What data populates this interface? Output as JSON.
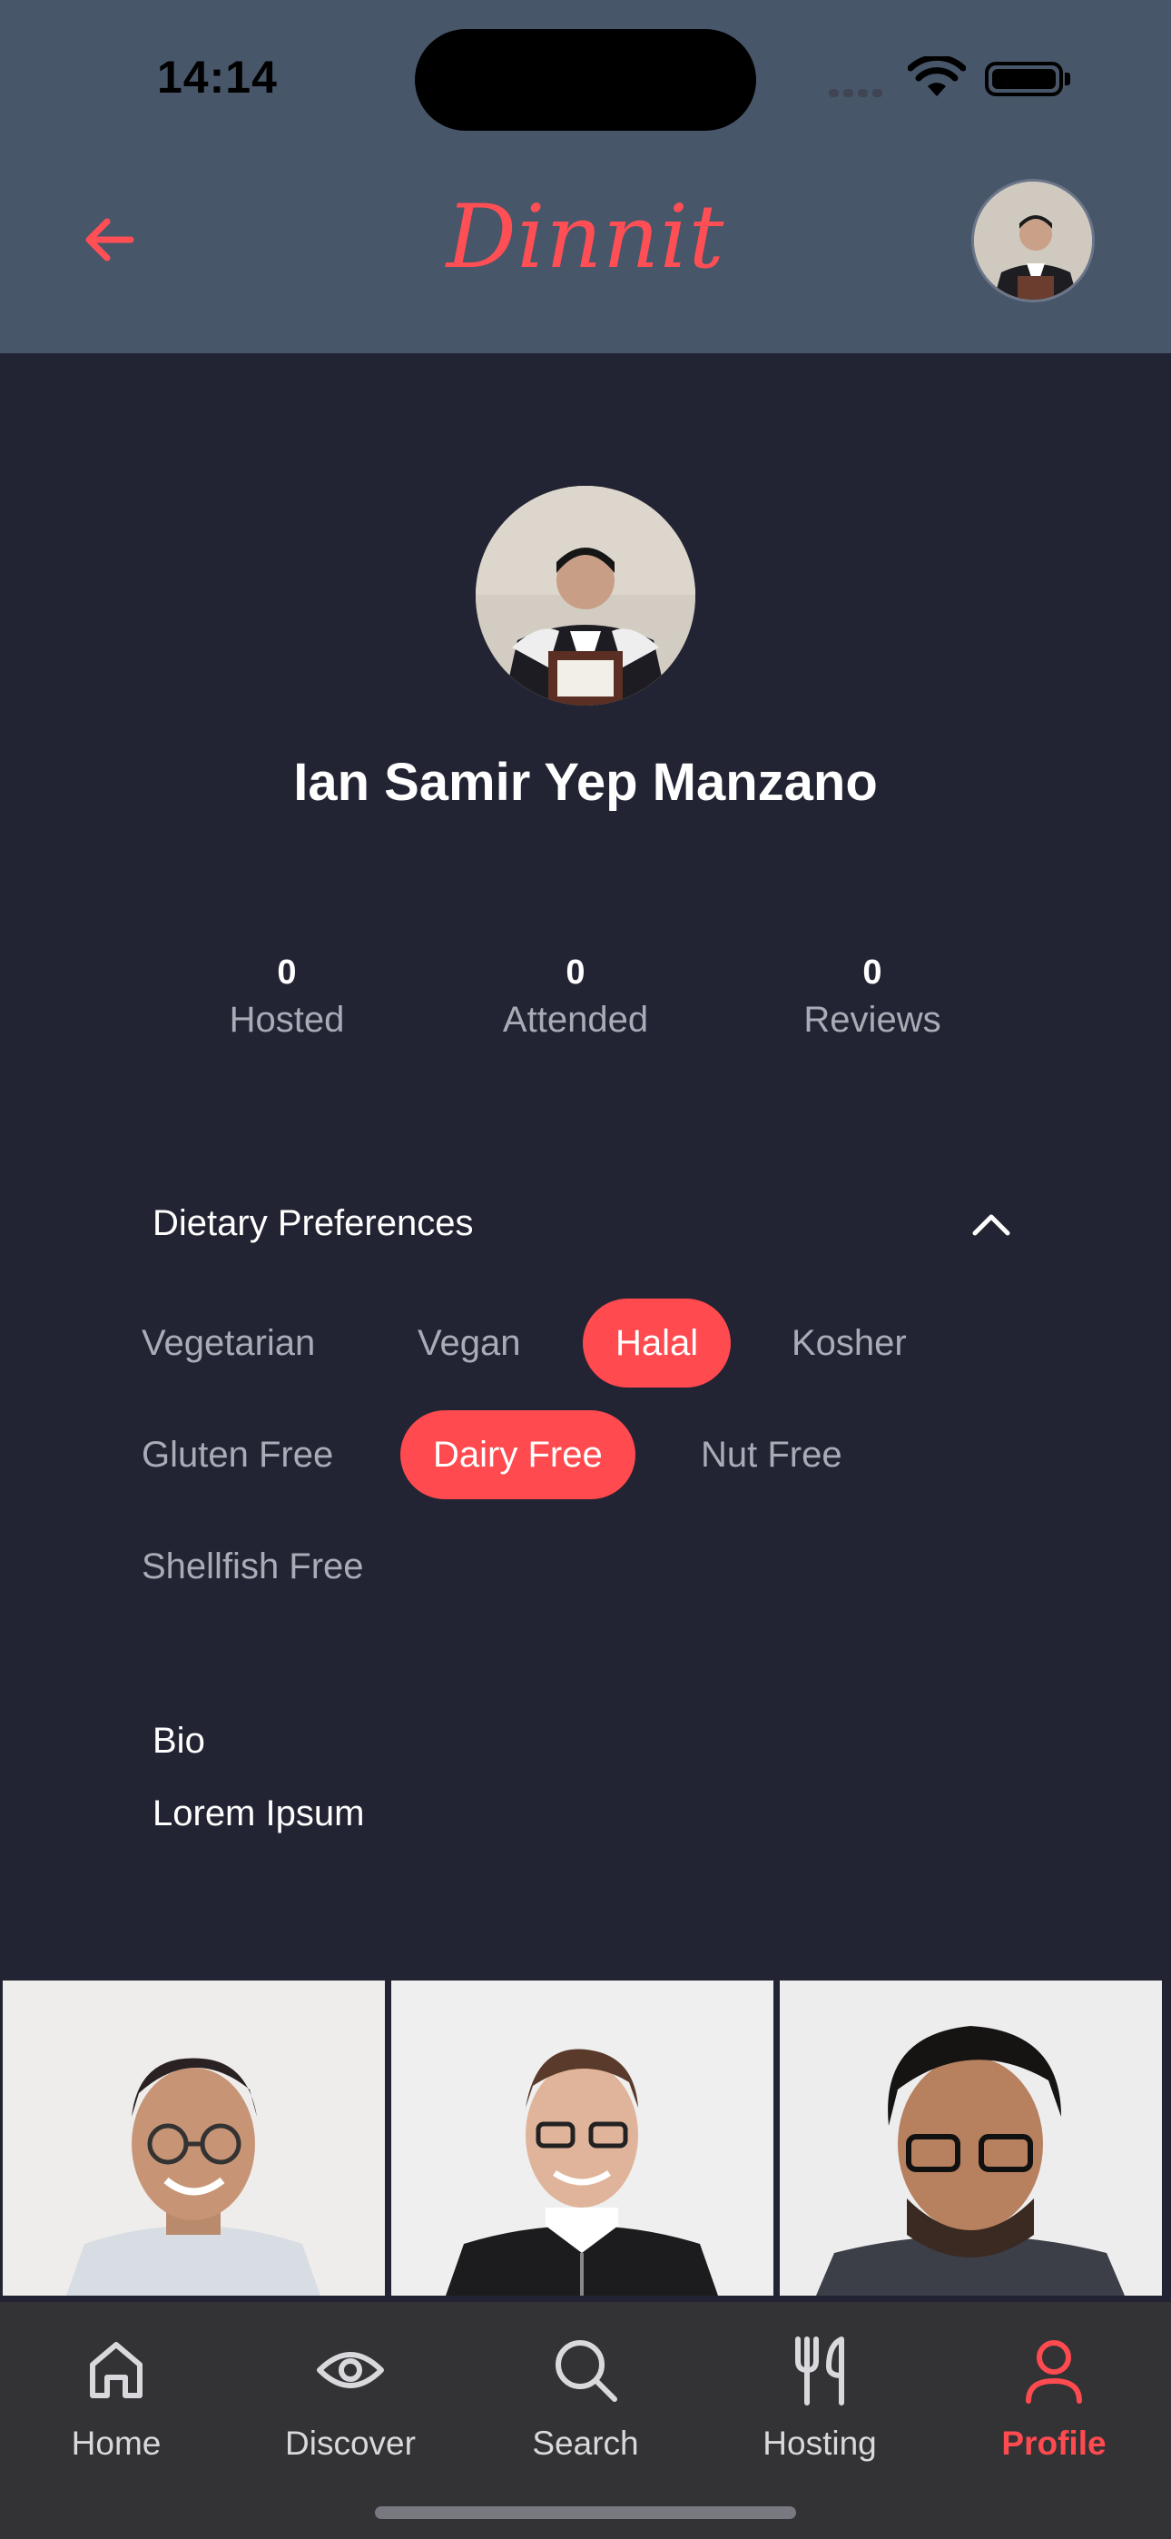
{
  "status_bar": {
    "time": "14:14"
  },
  "header": {
    "logo": "Dinnit"
  },
  "profile": {
    "name": "Ian Samir Yep Manzano"
  },
  "stats": [
    {
      "value": "0",
      "label": "Hosted"
    },
    {
      "value": "0",
      "label": "Attended"
    },
    {
      "value": "0",
      "label": "Reviews"
    }
  ],
  "dietary": {
    "title": "Dietary Preferences",
    "options": [
      {
        "label": "Vegetarian",
        "selected": false
      },
      {
        "label": "Vegan",
        "selected": false
      },
      {
        "label": "Halal",
        "selected": true
      },
      {
        "label": "Kosher",
        "selected": false
      },
      {
        "label": "Gluten Free",
        "selected": false
      },
      {
        "label": "Dairy Free",
        "selected": true
      },
      {
        "label": "Nut Free",
        "selected": false
      },
      {
        "label": "Shellfish Free",
        "selected": false
      }
    ]
  },
  "bio": {
    "title": "Bio",
    "text": "Lorem Ipsum"
  },
  "nav": {
    "items": [
      {
        "label": "Home",
        "icon": "home-icon"
      },
      {
        "label": "Discover",
        "icon": "eye-icon"
      },
      {
        "label": "Search",
        "icon": "search-icon"
      },
      {
        "label": "Hosting",
        "icon": "fork-knife-icon"
      },
      {
        "label": "Profile",
        "icon": "person-icon",
        "active": true
      }
    ]
  },
  "colors": {
    "accent": "#ff4a4f",
    "header_bg": "#48566a",
    "page_bg": "#232433",
    "nav_bg": "#333336"
  }
}
